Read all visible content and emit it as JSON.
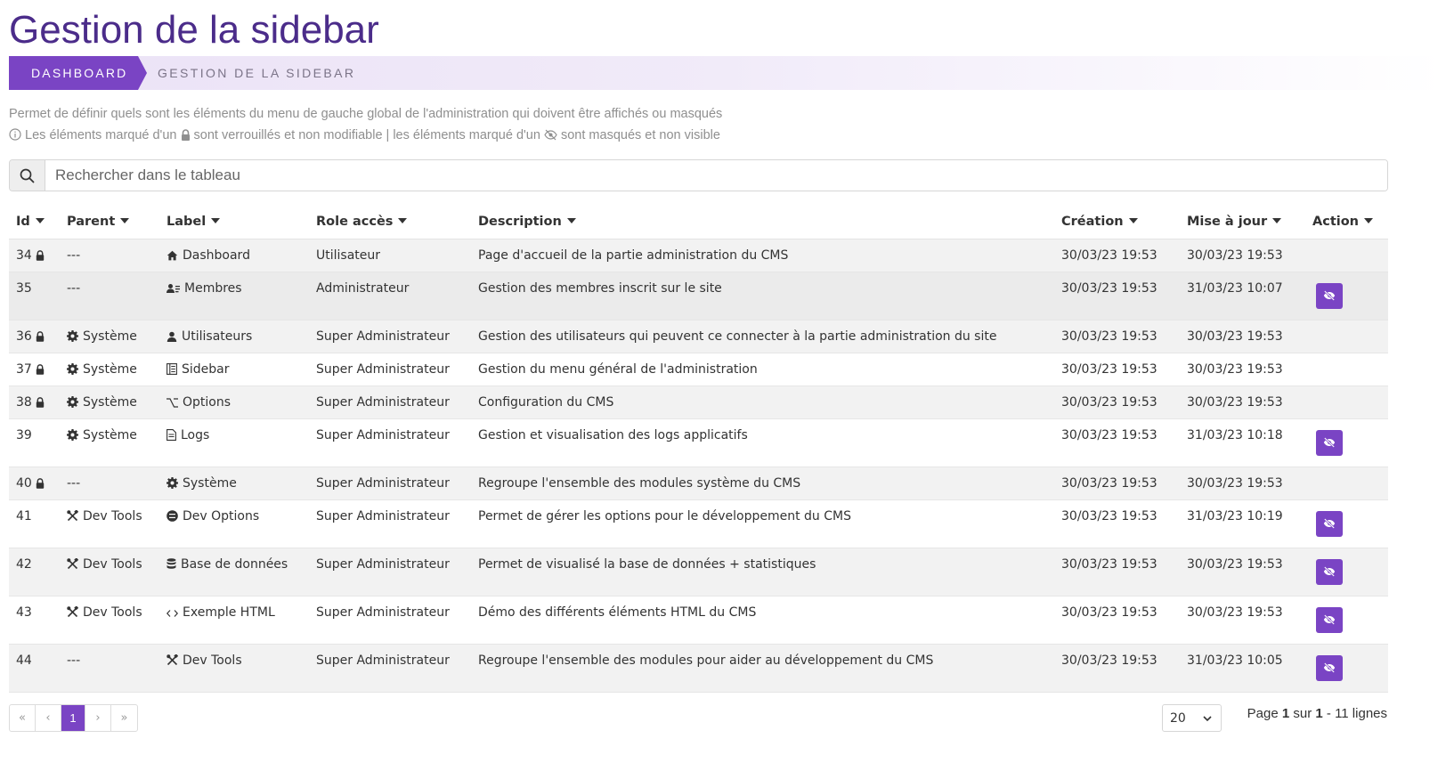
{
  "page": {
    "title": "Gestion de la sidebar",
    "breadcrumb": [
      "DASHBOARD",
      "GESTION DE LA SIDEBAR"
    ],
    "description": "Permet de définir quels sont les éléments du menu de gauche global de l'administration qui doivent être affichés ou masqués",
    "legend": {
      "part1": "Les éléments marqué d'un",
      "part2": "sont verrouillés et non modifiable | les éléments marqué d'un",
      "part3": "sont masqués et non visible"
    }
  },
  "search": {
    "placeholder": "Rechercher dans le tableau"
  },
  "table": {
    "columns": [
      "Id",
      "Parent",
      "Label",
      "Role accès",
      "Description",
      "Création",
      "Mise à jour",
      "Action"
    ],
    "rows": [
      {
        "id": "34",
        "locked": true,
        "parent": "---",
        "parent_icon": "",
        "label": "Dashboard",
        "label_icon": "home-icon",
        "role": "Utilisateur",
        "description": "Page d'accueil de la partie administration du CMS",
        "created": "30/03/23 19:53",
        "updated": "30/03/23 19:53",
        "hidden": false
      },
      {
        "id": "35",
        "locked": false,
        "parent": "---",
        "parent_icon": "",
        "label": "Membres",
        "label_icon": "members-icon",
        "role": "Administrateur",
        "description": "Gestion des membres inscrit sur le site",
        "created": "30/03/23 19:53",
        "updated": "31/03/23 10:07",
        "hidden": true
      },
      {
        "id": "36",
        "locked": true,
        "parent": "Système",
        "parent_icon": "gear-icon",
        "label": "Utilisateurs",
        "label_icon": "user-icon",
        "role": "Super Administrateur",
        "description": "Gestion des utilisateurs qui peuvent ce connecter à la partie administration du site",
        "created": "30/03/23 19:53",
        "updated": "30/03/23 19:53",
        "hidden": false
      },
      {
        "id": "37",
        "locked": true,
        "parent": "Système",
        "parent_icon": "gear-icon",
        "label": "Sidebar",
        "label_icon": "sidebar-icon",
        "role": "Super Administrateur",
        "description": "Gestion du menu général de l'administration",
        "created": "30/03/23 19:53",
        "updated": "30/03/23 19:53",
        "hidden": false
      },
      {
        "id": "38",
        "locked": true,
        "parent": "Système",
        "parent_icon": "gear-icon",
        "label": "Options",
        "label_icon": "option-key-icon",
        "role": "Super Administrateur",
        "description": "Configuration du CMS",
        "created": "30/03/23 19:53",
        "updated": "30/03/23 19:53",
        "hidden": false
      },
      {
        "id": "39",
        "locked": false,
        "parent": "Système",
        "parent_icon": "gear-icon",
        "label": "Logs",
        "label_icon": "file-icon",
        "role": "Super Administrateur",
        "description": "Gestion et visualisation des logs applicatifs",
        "created": "30/03/23 19:53",
        "updated": "31/03/23 10:18",
        "hidden": true
      },
      {
        "id": "40",
        "locked": true,
        "parent": "---",
        "parent_icon": "",
        "label": "Système",
        "label_icon": "gear-icon",
        "role": "Super Administrateur",
        "description": "Regroupe l'ensemble des modules système du CMS",
        "created": "30/03/23 19:53",
        "updated": "30/03/23 19:53",
        "hidden": false
      },
      {
        "id": "41",
        "locked": false,
        "parent": "Dev Tools",
        "parent_icon": "tools-icon",
        "label": "Dev Options",
        "label_icon": "options-circle-icon",
        "role": "Super Administrateur",
        "description": "Permet de gérer les options pour le développement du CMS",
        "created": "30/03/23 19:53",
        "updated": "31/03/23 10:19",
        "hidden": true
      },
      {
        "id": "42",
        "locked": false,
        "parent": "Dev Tools",
        "parent_icon": "tools-icon",
        "label": "Base de données",
        "label_icon": "database-icon",
        "role": "Super Administrateur",
        "description": "Permet de visualisé la base de données + statistiques",
        "created": "30/03/23 19:53",
        "updated": "30/03/23 19:53",
        "hidden": true
      },
      {
        "id": "43",
        "locked": false,
        "parent": "Dev Tools",
        "parent_icon": "tools-icon",
        "label": "Exemple HTML",
        "label_icon": "code-icon",
        "role": "Super Administrateur",
        "description": "Démo des différents éléments HTML du CMS",
        "created": "30/03/23 19:53",
        "updated": "30/03/23 19:53",
        "hidden": true
      },
      {
        "id": "44",
        "locked": false,
        "parent": "---",
        "parent_icon": "",
        "label": "Dev Tools",
        "label_icon": "tools-icon",
        "role": "Super Administrateur",
        "description": "Regroupe l'ensemble des modules pour aider au développement du CMS",
        "created": "30/03/23 19:53",
        "updated": "31/03/23 10:05",
        "hidden": true
      }
    ]
  },
  "pagination": {
    "buttons": [
      "«",
      "‹",
      "1",
      "›",
      "»"
    ],
    "per_page": "20",
    "info": {
      "prefix": "Page",
      "current": "1",
      "sep": "sur",
      "total": "1",
      "suffix": "- 11 lignes"
    }
  },
  "colors": {
    "accent": "#7a44c4",
    "title": "#4b2c8a"
  }
}
